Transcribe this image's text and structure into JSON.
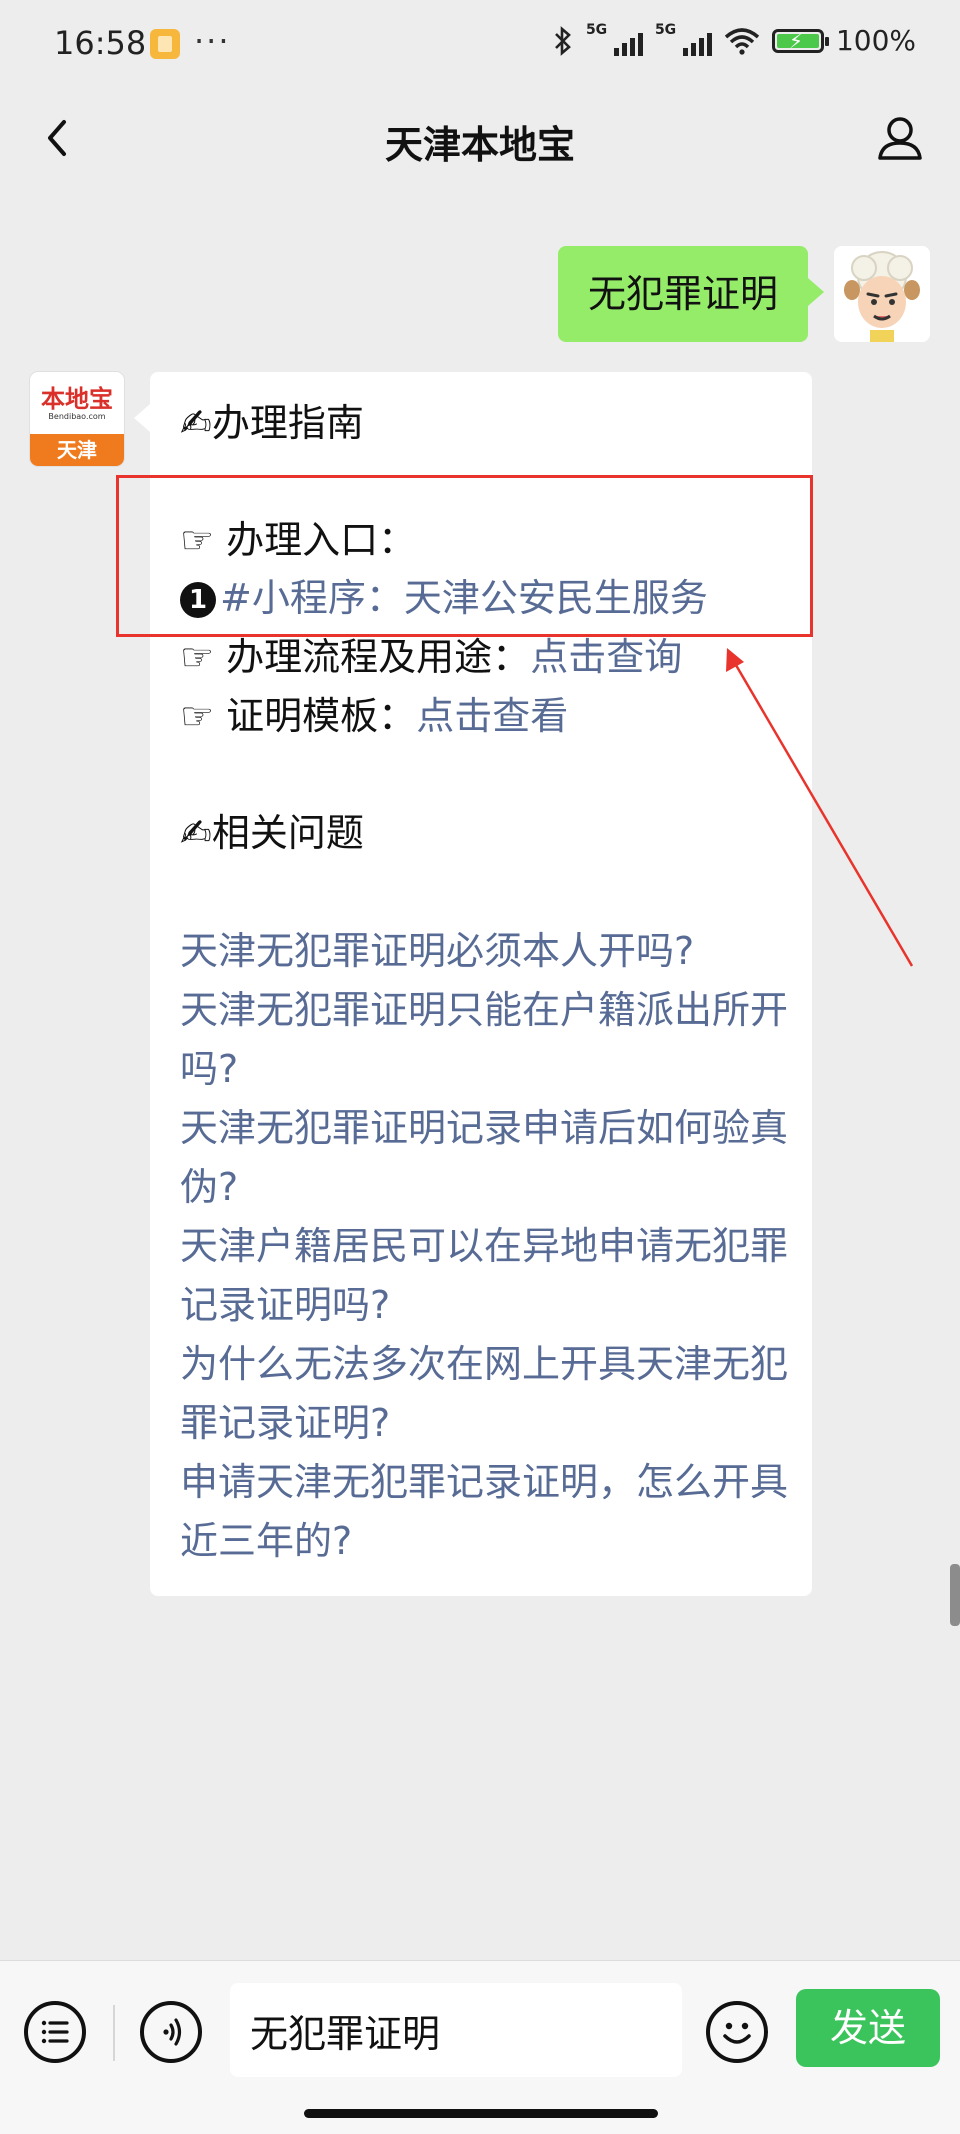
{
  "status_bar": {
    "time": "16:58",
    "more": "···",
    "network_1": "5G",
    "network_2": "5G",
    "battery_percent": "100%",
    "battery_level": 1.0
  },
  "header": {
    "title": "天津本地宝"
  },
  "chat": {
    "outgoing_message": "无犯罪证明",
    "bot": {
      "logo_name": "本地宝",
      "logo_site": "Bendibao.com",
      "logo_city": "天津"
    },
    "reply": {
      "guide_emoji": "✍",
      "guide_title": "办理指南",
      "pointer": "☞",
      "entry_label": "办理入口：",
      "entry_number": "1",
      "entry_link": "#小程序：天津公安民生服务",
      "process_label": "办理流程及用途：",
      "process_link": "点击查询",
      "template_label": "证明模板：",
      "template_link": "点击查看",
      "related_emoji": "✍",
      "related_title": "相关问题",
      "questions": [
        "天津无犯罪证明必须本人开吗?",
        "天津无犯罪证明只能在户籍派出所开吗?",
        "天津无犯罪证明记录申请后如何验真伪?",
        "天津户籍居民可以在异地申请无犯罪记录证明吗?",
        "为什么无法多次在网上开具天津无犯罪记录证明?",
        "申请天津无犯罪记录证明，怎么开具近三年的?"
      ]
    }
  },
  "input_bar": {
    "input_value": "无犯罪证明",
    "send_label": "发送"
  },
  "colors": {
    "outgoing_bubble": "#95ec69",
    "link": "#576b95",
    "send_button": "#3bc45c",
    "annotation": "#e8342c"
  }
}
